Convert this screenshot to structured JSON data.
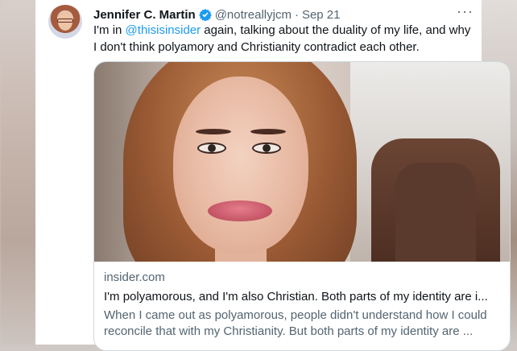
{
  "tweet": {
    "author_name": "Jennifer C. Martin",
    "handle": "@notreallyjcm",
    "separator": "·",
    "date": "Sep 21",
    "more_label": "···",
    "text_before": "I'm in ",
    "mention": "@thisisinsider",
    "text_after": " again, talking about the duality of my life, and why I don't think polyamory and Christianity contradict each other.",
    "icons": {
      "verified": "verified-badge-icon",
      "more": "more-options-icon"
    },
    "colors": {
      "link": "#1d9bf0",
      "secondary_text": "#536471",
      "primary_text": "#0f1419"
    }
  },
  "link_card": {
    "domain": "insider.com",
    "title": "I'm polyamorous, and I'm also Christian. Both parts of my identity are i...",
    "description_line1": "When I came out as polyamorous, people didn't understand how I could",
    "description_line2": "reconcile that with my Christianity. But both parts of my identity are ..."
  }
}
